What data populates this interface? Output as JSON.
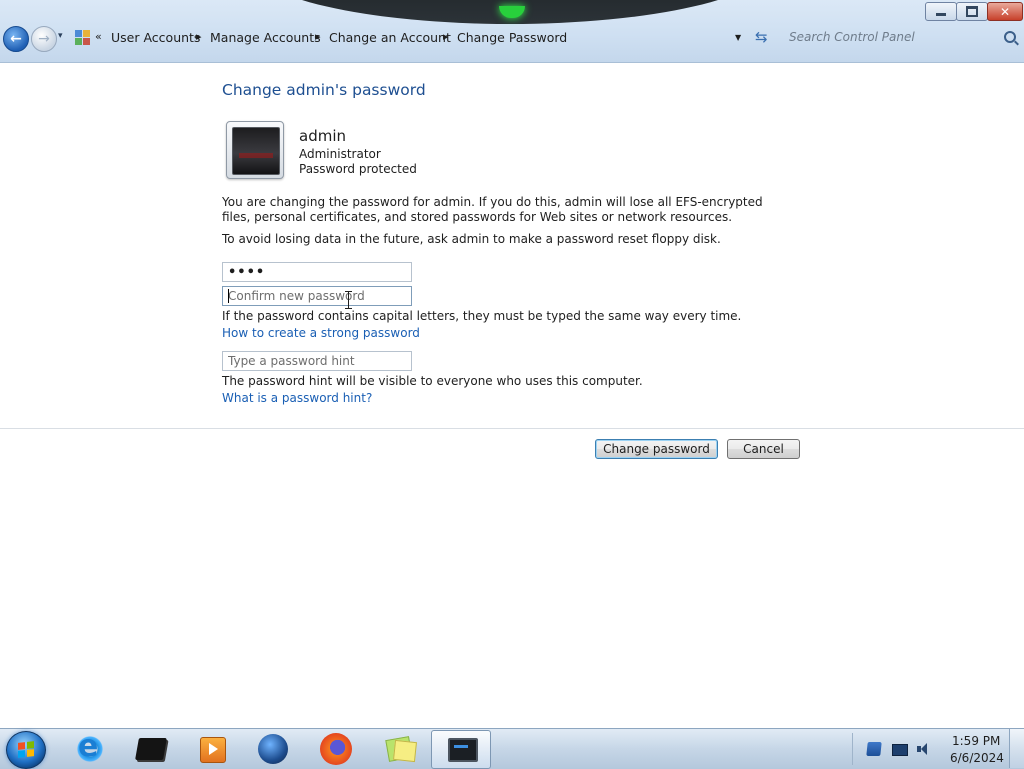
{
  "window": {
    "minimize_icon": "minimize-icon",
    "maximize_icon": "restore-icon",
    "close_icon": "close-icon",
    "close_glyph": "✕"
  },
  "nav": {
    "back_glyph": "←",
    "forward_glyph": "→",
    "recent_glyph": "▾",
    "overflow": "«",
    "breadcrumbs": [
      {
        "label": "User Accounts"
      },
      {
        "label": "Manage Accounts"
      },
      {
        "label": "Change an Account"
      },
      {
        "label": "Change Password"
      }
    ],
    "separator": "▸",
    "address_dropdown": "▼",
    "refresh_glyph": "⇆"
  },
  "search": {
    "placeholder": "Search Control Panel"
  },
  "content": {
    "title": "Change admin's password",
    "user": {
      "name": "admin",
      "role": "Administrator",
      "status": "Password protected"
    },
    "warning": "You are changing the password for admin.  If you do this, admin will lose all EFS-encrypted files, personal certificates, and stored passwords for Web sites or network resources.",
    "avoid": "To avoid losing data in the future, ask admin to make a password reset floppy disk.",
    "new_password": {
      "value": "••••"
    },
    "confirm_password": {
      "placeholder": "Confirm new password",
      "value": ""
    },
    "caps_note": "If the password contains capital letters, they must be typed the same way every time.",
    "strong_password_link": "How to create a strong password",
    "hint": {
      "placeholder": "Type a password hint",
      "value": ""
    },
    "hint_note": "The password hint will be visible to everyone who uses this computer.",
    "hint_link": "What is a password hint?",
    "buttons": {
      "change": "Change password",
      "cancel": "Cancel"
    }
  },
  "taskbar": {
    "pinned": [
      {
        "name": "internet-explorer-icon"
      },
      {
        "name": "app-icon"
      },
      {
        "name": "media-player-icon"
      },
      {
        "name": "globe-icon"
      },
      {
        "name": "firefox-icon"
      },
      {
        "name": "sticky-notes-icon"
      },
      {
        "name": "control-panel-icon",
        "active": true
      }
    ],
    "clock": {
      "time": "1:59 PM",
      "date": "6/6/2024"
    }
  },
  "colors": {
    "link": "#1a5fb4",
    "title": "#1e4f91",
    "chrome": "#cfe0f2"
  }
}
